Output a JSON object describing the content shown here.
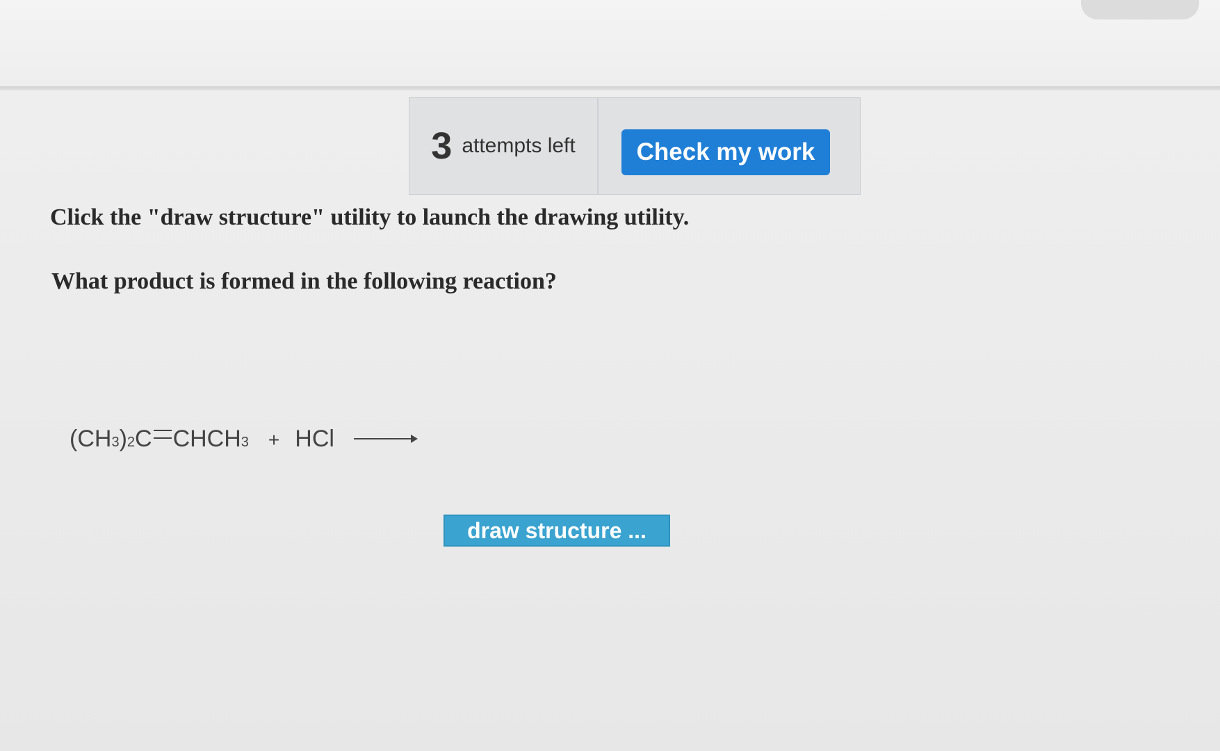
{
  "attempts": {
    "count": "3",
    "label": "attempts left"
  },
  "actions": {
    "check_label": "Check my work",
    "draw_label": "draw structure ..."
  },
  "prompt": {
    "instruction": "Click the \"draw structure\" utility to launch the drawing utility.",
    "question": "What product is formed in the following reaction?"
  },
  "reaction": {
    "reactant1_part1": "(CH",
    "sub1": "3",
    "part2": ")",
    "sub2": "2",
    "part3": "C",
    "part4": "CHCH",
    "sub3": "3",
    "plus": "+",
    "reactant2": "HCl"
  },
  "colors": {
    "check_button": "#1f7fd6",
    "draw_button": "#3aa3cf"
  },
  "icons": {
    "arrow": "reaction-arrow-icon"
  }
}
